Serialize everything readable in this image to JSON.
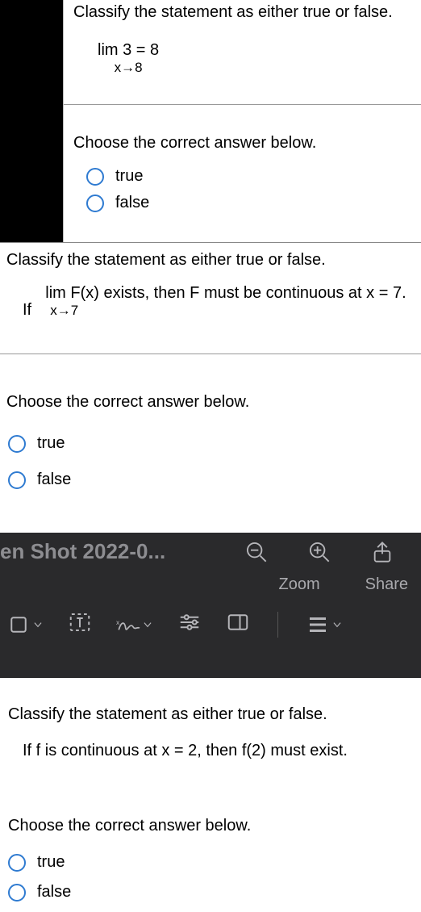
{
  "q1": {
    "prompt": "Classify the statement as either true or false.",
    "limit_top": "lim 3 = 8",
    "limit_sub": "x→8",
    "answer_prompt": "Choose the correct answer below.",
    "options": [
      "true",
      "false"
    ]
  },
  "q2": {
    "prompt": "Classify the statement as either true or false.",
    "stmt_prefix": "If",
    "stmt_lim_top": "lim F(x) exists, then F must be continuous at x = 7.",
    "stmt_lim_sub": "x→7",
    "answer_prompt": "Choose the correct answer below.",
    "options": [
      "true",
      "false"
    ]
  },
  "viewer": {
    "title": "en Shot 2022-0...",
    "zoom_label": "Zoom",
    "share_label": "Share"
  },
  "q3": {
    "prompt": "Classify the statement as either true or false.",
    "stmt": "If f is continuous at x = 2, then f(2) must exist.",
    "answer_prompt": "Choose the correct answer below.",
    "options": [
      "true",
      "false"
    ]
  }
}
